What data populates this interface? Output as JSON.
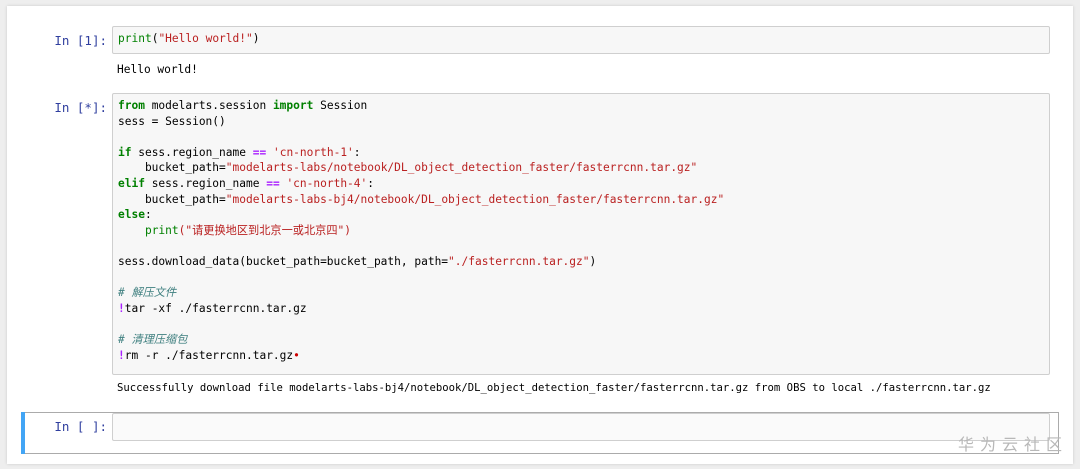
{
  "cells": [
    {
      "prompt": "In  [1]:",
      "output": "Hello world!"
    },
    {
      "prompt": "In  [*]:",
      "output": "Successfully download file modelarts-labs-bj4/notebook/DL_object_detection_faster/fasterrcnn.tar.gz from OBS to local ./fasterrcnn.tar.gz"
    },
    {
      "prompt": "In  [ ]:"
    }
  ],
  "code1": {
    "fn": "print",
    "arg": "\"Hello world!\""
  },
  "code2": {
    "l1_from": "from",
    "l1_mod": " modelarts.session ",
    "l1_import": "import",
    "l1_name": " Session",
    "l2": "sess = Session()",
    "l4_if": "if",
    "l4_mid": " sess.region_name ",
    "l4_op": "==",
    "l4_str": "'cn-north-1'",
    "l4_end": ":",
    "l5_pre": "    bucket_path=",
    "l5_str": "\"modelarts-labs/notebook/DL_object_detection_faster/fasterrcnn.tar.gz\"",
    "l6_elif": "elif",
    "l6_mid": " sess.region_name ",
    "l6_op": "==",
    "l6_str": "'cn-north-4'",
    "l6_end": ":",
    "l7_pre": "    bucket_path=",
    "l7_str": "\"modelarts-labs-bj4/notebook/DL_object_detection_faster/fasterrcnn.tar.gz\"",
    "l8_else": "else",
    "l8_end": ":",
    "l9_pre": "    ",
    "l9_fn": "print",
    "l9_str": "(\"请更换地区到北京一或北京四\")",
    "l11_pre": "sess.download_data(bucket_path=bucket_path, path=",
    "l11_str": "\"./fasterrcnn.tar.gz\"",
    "l11_end": ")",
    "l13_comment": "# 解压文件",
    "l14_bang": "!",
    "l14_cmd": "tar -xf ./fasterrcnn.tar.gz",
    "l16_comment": "# 清理压缩包",
    "l17_bang": "!",
    "l17_cmd": "rm -r ./fasterrcnn.tar.gz",
    "l17_mark": "•"
  },
  "watermark": "华为云社区"
}
